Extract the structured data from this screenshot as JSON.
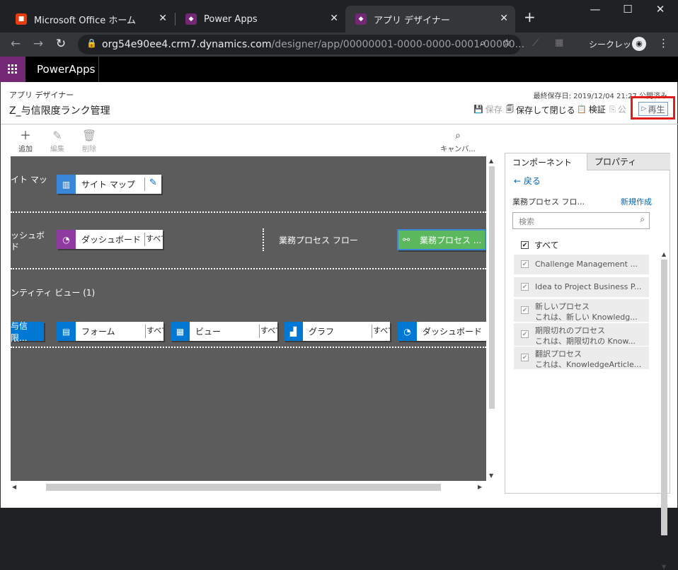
{
  "browser": {
    "tabs": [
      {
        "label": "Microsoft Office ホーム",
        "favicon": "office-icon"
      },
      {
        "label": "Power Apps",
        "favicon": "powerapps-icon"
      },
      {
        "label": "アプリ デザイナー",
        "favicon": "powerapps-icon"
      }
    ],
    "url_host": "org54e90ee4.crm7.dynamics.com",
    "url_path": "/designer/app/00000001-0000-0000-0001-00000...",
    "incognito_label": "シークレット"
  },
  "app_header": {
    "title": "PowerApps"
  },
  "designer": {
    "subtitle": "アプリ デザイナー",
    "title": "Z_与信限度ランク管理",
    "last_saved": "最終保存日: 2019/12/04 21:27 公開済み",
    "commands": {
      "save": "保存",
      "save_close": "保存して閉じる",
      "validate": "検証",
      "publish": "公",
      "play": "再生"
    },
    "toolbar": {
      "add": "追加",
      "edit": "編集",
      "delete": "削除",
      "canvas": "キャンバ..."
    }
  },
  "canvas": {
    "sitemap_label": "イト マッ",
    "sitemap_tile": "サイト マップ",
    "dashboard_label_1": "ッシュボ",
    "dashboard_label_2": "ド",
    "dashboard_tile": "ダッシュボード",
    "dashboard_all": "すべて",
    "bpf_label": "業務プロセス フロー",
    "bpf_tile": "業務プロセス ...",
    "entity_header": "ンティティ ビュー (1)",
    "entity_tile": "与信限...",
    "form_tile": "フォーム",
    "view_tile": "ビュー",
    "chart_tile": "グラフ",
    "dash2_tile": "ダッシュボード",
    "all": "すべて"
  },
  "panel": {
    "tab_components": "コンポーネント",
    "tab_properties": "プロパティ",
    "back": "戻る",
    "section_title": "業務プロセス フロ...",
    "new_link": "新規作成",
    "search_placeholder": "検索",
    "select_all": "すべて",
    "items": [
      {
        "title": "Challenge Management ...",
        "desc": ""
      },
      {
        "title": "Idea to Project Business P...",
        "desc": ""
      },
      {
        "title": "新しいプロセス",
        "desc": "これは、新しい Knowledg..."
      },
      {
        "title": "期限切れのプロセス",
        "desc": "これは、期限切れの Know..."
      },
      {
        "title": "翻訳プロセス",
        "desc": "これは、KnowledgeArticle..."
      }
    ]
  },
  "colors": {
    "powerapps_purple": "#742774",
    "highlight_red": "#e21b1b",
    "tile_blue": "#0078d4",
    "tile_green": "#5bb85d"
  }
}
